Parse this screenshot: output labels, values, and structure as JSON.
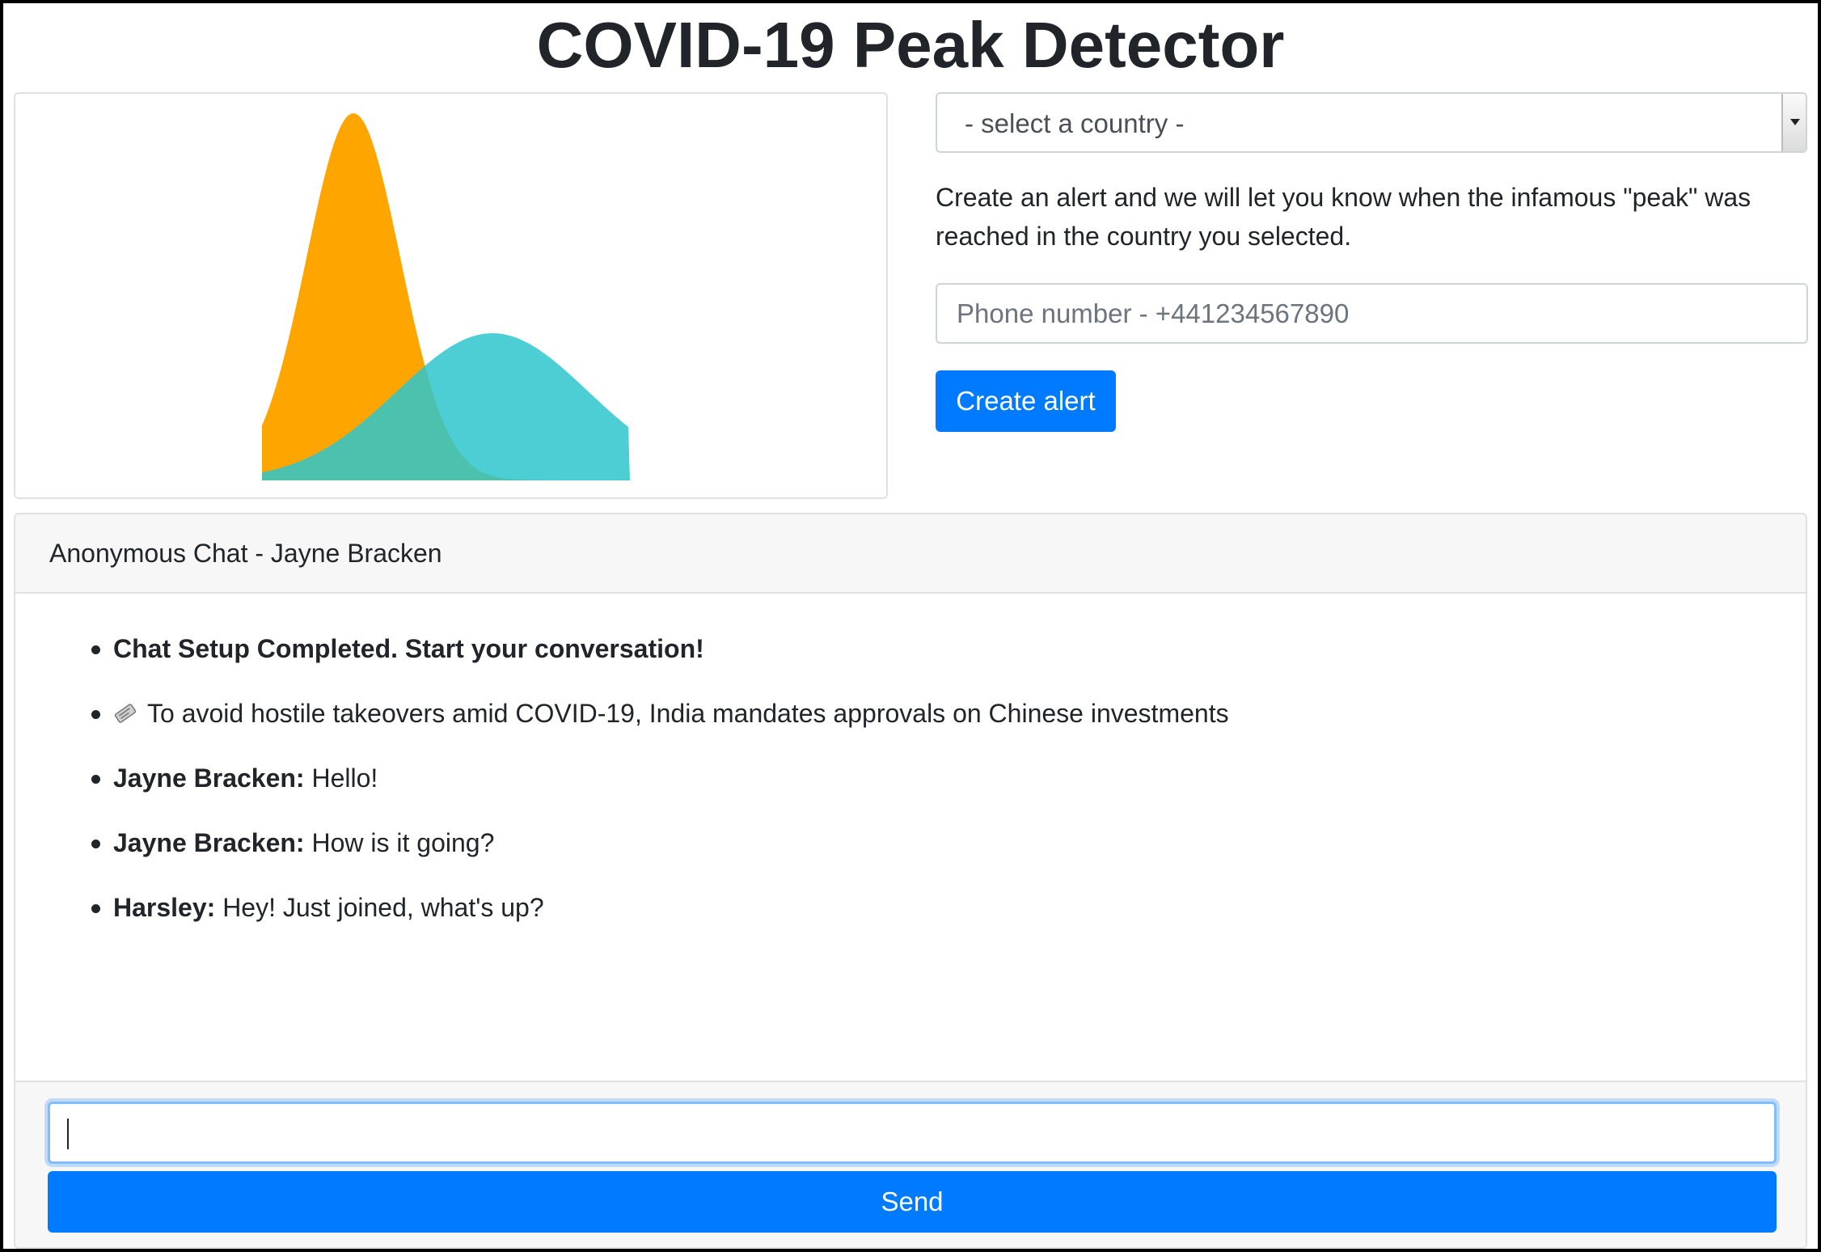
{
  "page": {
    "title": "COVID-19 Peak Detector"
  },
  "chart": {
    "colors": {
      "peak_curve": "#FFA500",
      "flat_curve": "#2DC5CC",
      "overlap": "#4DAFB5"
    }
  },
  "alert": {
    "country_select": {
      "selected": "- select a country -"
    },
    "description": "Create an alert and we will let you know when the infamous \"peak\" was reached in the country you selected.",
    "phone_placeholder": "Phone number - +441234567890",
    "button_label": "Create alert"
  },
  "chat": {
    "header": "Anonymous Chat - Jayne Bracken",
    "messages": [
      {
        "sender": "",
        "text": "Chat Setup Completed. Start your conversation!"
      },
      {
        "icon": "newspaper-icon",
        "text": "To avoid hostile takeovers amid COVID-19, India mandates approvals on Chinese investments"
      },
      {
        "sender": "Jayne Bracken:",
        "text": " Hello!"
      },
      {
        "sender": "Jayne Bracken:",
        "text": " How is it going?"
      },
      {
        "sender": "Harsley:",
        "text": " Hey! Just joined, what's up?"
      }
    ],
    "input_value": "",
    "send_label": "Send"
  },
  "colors": {
    "primary": "#007bff",
    "header_bg": "#f7f7f7",
    "border": "#e1e1e1"
  }
}
